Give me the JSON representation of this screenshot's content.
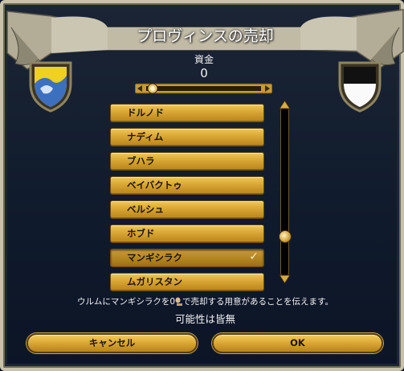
{
  "dialog": {
    "title": "プロヴィンスの売却",
    "gold_label": "資金",
    "gold_value": "0"
  },
  "provinces": [
    {
      "label": "ドルノド",
      "selected": false
    },
    {
      "label": "ナディム",
      "selected": false
    },
    {
      "label": "ブハラ",
      "selected": false
    },
    {
      "label": "ベイバクトゥ",
      "selected": false
    },
    {
      "label": "ベルシュ",
      "selected": false
    },
    {
      "label": "ホブド",
      "selected": false
    },
    {
      "label": "マンギシラク",
      "selected": true
    },
    {
      "label": "ムガリスタン",
      "selected": false
    }
  ],
  "message": {
    "before": "ウルムにマンギシラクを0",
    "after": "で売却する用意があることを伝えます。"
  },
  "chance_text": "可能性は皆無",
  "buttons": {
    "cancel": "キャンセル",
    "ok": "OK"
  },
  "colors": {
    "button_gold": "#d8a634",
    "background": "#0f1a2c",
    "left_shield": "#f0d020",
    "right_shield": "#ffffff"
  },
  "icons": {
    "check": "✓",
    "coin": "gold-coin-icon"
  }
}
